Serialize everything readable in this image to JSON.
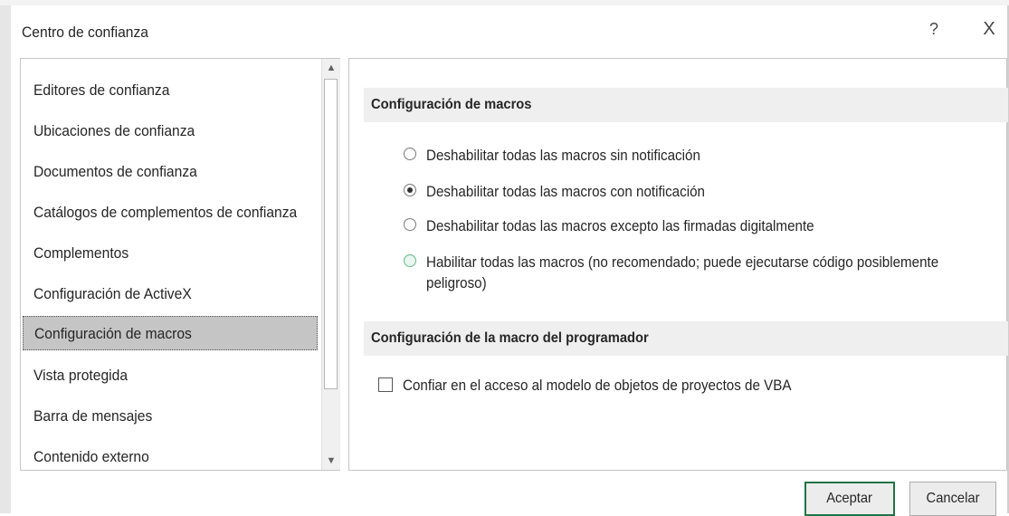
{
  "dialog": {
    "title": "Centro de confianza",
    "help_label": "?",
    "close_label": "X"
  },
  "nav": {
    "items": [
      {
        "label": "Editores de confianza"
      },
      {
        "label": "Ubicaciones de confianza"
      },
      {
        "label": "Documentos de confianza"
      },
      {
        "label": "Catálogos de complementos de confianza"
      },
      {
        "label": "Complementos"
      },
      {
        "label": "Configuración de ActiveX"
      },
      {
        "label": "Configuración de macros",
        "selected": true
      },
      {
        "label": "Vista protegida"
      },
      {
        "label": "Barra de mensajes"
      },
      {
        "label": "Contenido externo"
      }
    ],
    "scroll_up": "▲",
    "scroll_down": "▼"
  },
  "macros": {
    "header": "Configuración de macros",
    "options": [
      {
        "label": "Deshabilitar todas las macros sin notificación",
        "checked": false
      },
      {
        "label": "Deshabilitar todas las macros con notificación",
        "checked": true
      },
      {
        "label": "Deshabilitar todas las macros excepto las firmadas digitalmente",
        "checked": false
      },
      {
        "label_line1": "Habilitar todas las macros (no recomendado; puede ejecutarse código posiblemente",
        "label_line2": "peligroso)",
        "checked": false
      }
    ]
  },
  "developer": {
    "header": "Configuración de la macro del programador",
    "vba_label": "Confiar en el acceso al modelo de objetos de proyectos de VBA",
    "vba_checked": false
  },
  "buttons": {
    "ok": "Aceptar",
    "cancel": "Cancelar"
  },
  "colors": {
    "selected_bg": "#c5c5c5",
    "ok_border": "#217346",
    "section_bg": "#efefef"
  }
}
